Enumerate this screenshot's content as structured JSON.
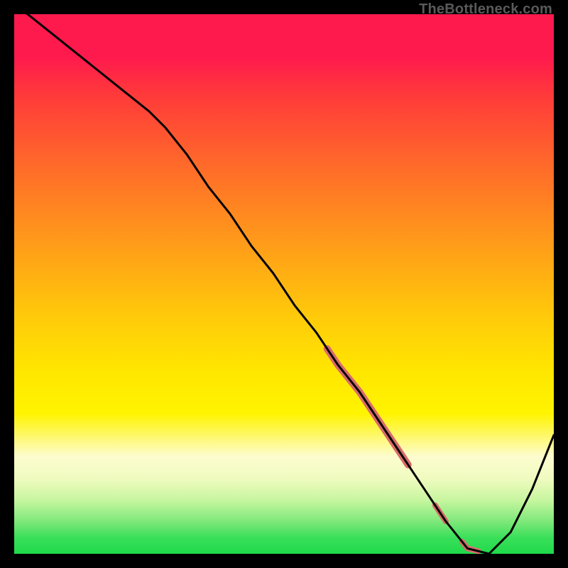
{
  "watermark": "TheBottleneck.com",
  "chart_data": {
    "type": "line",
    "title": "",
    "xlabel": "",
    "ylabel": "",
    "xlim": [
      0,
      100
    ],
    "ylim": [
      0,
      100
    ],
    "series": [
      {
        "name": "bottleneck-curve",
        "x": [
          0,
          5,
          10,
          15,
          20,
          25,
          28,
          32,
          36,
          40,
          44,
          48,
          52,
          56,
          60,
          64,
          68,
          72,
          76,
          80,
          84,
          88,
          92,
          96,
          100
        ],
        "y": [
          102,
          98,
          94,
          90,
          86,
          82,
          79,
          74,
          68,
          63,
          57,
          52,
          46,
          41,
          35,
          30,
          24,
          18,
          12,
          6,
          1,
          0,
          4,
          12,
          22
        ]
      }
    ],
    "highlight_band": {
      "name": "optimal-region-marker",
      "color": "#d96b6b",
      "segments": [
        {
          "x_start": 58,
          "x_end": 73,
          "width": 10
        },
        {
          "x_start": 78,
          "x_end": 80,
          "width": 8
        },
        {
          "x_start": 83,
          "x_end": 86,
          "width": 8
        }
      ]
    },
    "gradient_stops": [
      {
        "pos": 0,
        "color": "#ff1a4d"
      },
      {
        "pos": 50,
        "color": "#ffd000"
      },
      {
        "pos": 85,
        "color": "#f5faa0"
      },
      {
        "pos": 100,
        "color": "#1fd94a"
      }
    ]
  }
}
